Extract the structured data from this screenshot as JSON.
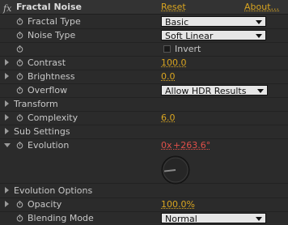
{
  "effect": {
    "fx_label": "fx",
    "name": "Fractal Noise",
    "reset_label": "Reset",
    "about_label": "About..."
  },
  "properties": {
    "fractal_type": {
      "label": "Fractal Type",
      "value": "Basic"
    },
    "noise_type": {
      "label": "Noise Type",
      "value": "Soft Linear"
    },
    "invert": {
      "label": "Invert",
      "checked": false
    },
    "contrast": {
      "label": "Contrast",
      "value": "100.0"
    },
    "brightness": {
      "label": "Brightness",
      "value": "0.0"
    },
    "overflow": {
      "label": "Overflow",
      "value": "Allow HDR Results"
    },
    "transform": {
      "label": "Transform"
    },
    "complexity": {
      "label": "Complexity",
      "value": "6.0"
    },
    "sub_settings": {
      "label": "Sub Settings"
    },
    "evolution": {
      "label": "Evolution",
      "revolutions": "0x",
      "angle": "+263.6°",
      "angle_degrees": 263.6
    },
    "evolution_options": {
      "label": "Evolution Options"
    },
    "opacity": {
      "label": "Opacity",
      "value": "100.0%"
    },
    "blending_mode": {
      "label": "Blending Mode",
      "value": "Normal"
    }
  },
  "colors": {
    "panel_bg": "#2b2b2b",
    "value_orange": "#d9a520",
    "value_red": "#e0504a",
    "dropdown_bg": "#e6e6e6"
  }
}
